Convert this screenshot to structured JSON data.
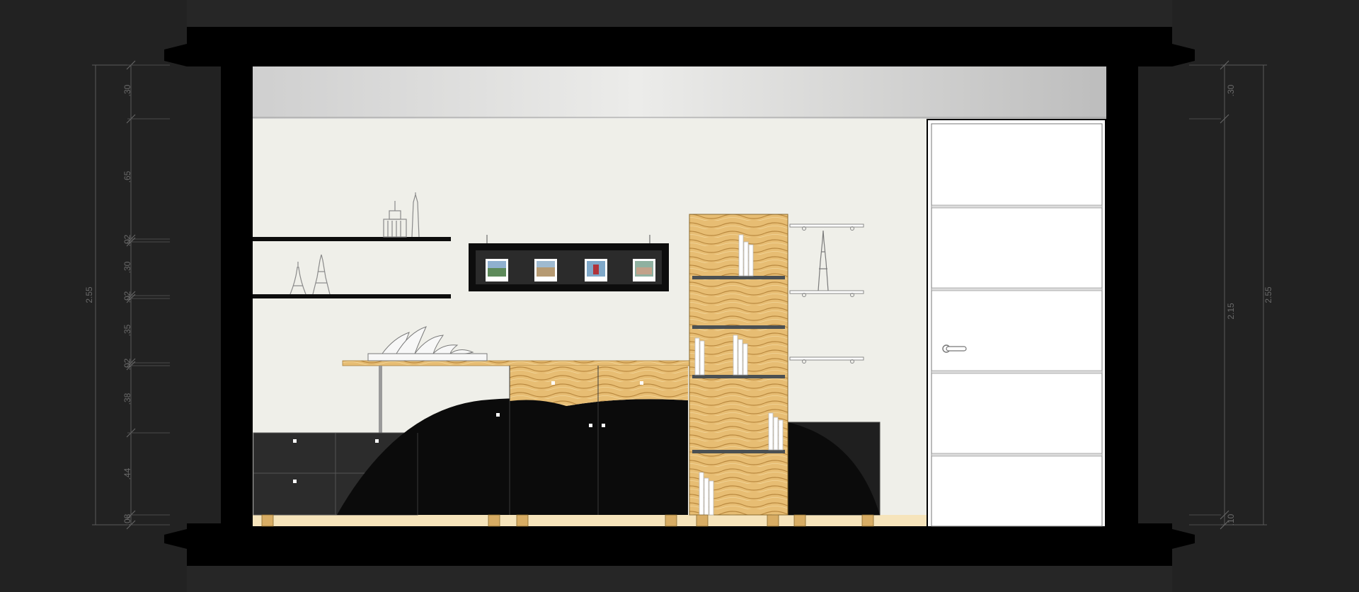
{
  "drawing": {
    "left_dimensions": {
      "total": "2.55",
      "segments": [
        ".30",
        ".65",
        ".02",
        ".30",
        ".02",
        ".35",
        ".02",
        ".38",
        ".44",
        ".08"
      ]
    },
    "right_dimensions": {
      "total": "2.55",
      "segments": [
        ".30",
        "2.15",
        ".10"
      ]
    },
    "colors": {
      "background": "#222222",
      "wall": "#efefe9",
      "ceiling": "#e2e2e0",
      "wood": "#e4b86c",
      "cabinet_black": "#0d0d0d",
      "door": "#ffffff"
    }
  }
}
